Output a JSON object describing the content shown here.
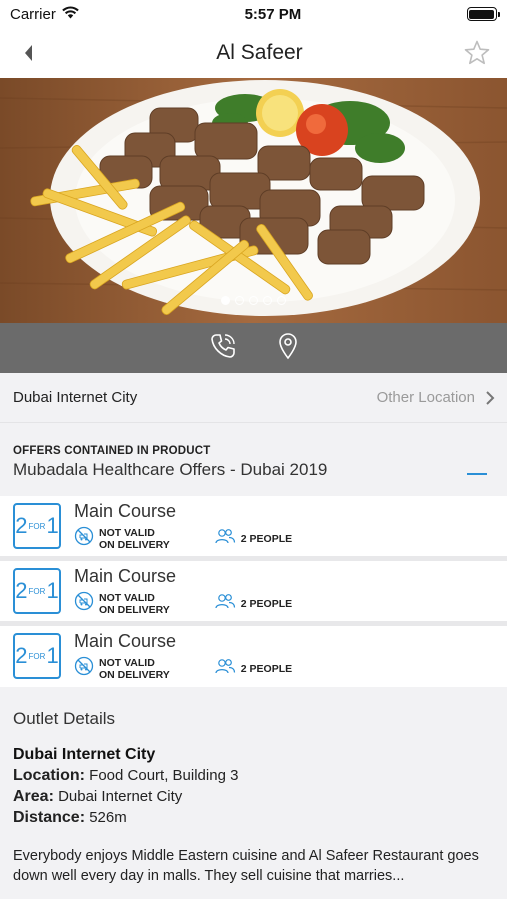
{
  "status_bar": {
    "carrier": "Carrier",
    "time": "5:57 PM",
    "battery_level": 1.0
  },
  "nav": {
    "title": "Al Safeer",
    "back_icon": "chevron-left-icon",
    "favorite_icon": "star-outline-icon"
  },
  "hero": {
    "carousel_count": 5,
    "active_index": 0
  },
  "actions": {
    "call_icon": "phone-icon",
    "map_icon": "map-pin-icon"
  },
  "location": {
    "name": "Dubai Internet City",
    "other_label": "Other Location"
  },
  "offers": {
    "caption": "OFFERS CONTAINED IN PRODUCT",
    "name": "Mubadala Healthcare Offers - Dubai 2019",
    "items": [
      {
        "badge_left": "2",
        "badge_mid": "FOR",
        "badge_right": "1",
        "title": "Main Course",
        "delivery_line1": "NOT VALID",
        "delivery_line2": "ON DELIVERY",
        "people": "2 PEOPLE"
      },
      {
        "badge_left": "2",
        "badge_mid": "FOR",
        "badge_right": "1",
        "title": "Main Course",
        "delivery_line1": "NOT VALID",
        "delivery_line2": "ON DELIVERY",
        "people": "2 PEOPLE"
      },
      {
        "badge_left": "2",
        "badge_mid": "FOR",
        "badge_right": "1",
        "title": "Main Course",
        "delivery_line1": "NOT VALID",
        "delivery_line2": "ON DELIVERY",
        "people": "2 PEOPLE"
      }
    ]
  },
  "details": {
    "title": "Outlet Details",
    "outlet_name": "Dubai Internet City",
    "location_label": "Location:",
    "location_value": " Food Court, Building 3",
    "area_label": "Area:",
    "area_value": " Dubai Internet City",
    "distance_label": "Distance:",
    "distance_value": " 526m",
    "description": "Everybody enjoys Middle Eastern cuisine and Al Safeer Restaurant goes down well every day in malls. They sell cuisine that marries..."
  },
  "colors": {
    "accent": "#2a8fd6",
    "action_bar": "#6b6b6b",
    "section_bg": "#f2f2f4"
  }
}
